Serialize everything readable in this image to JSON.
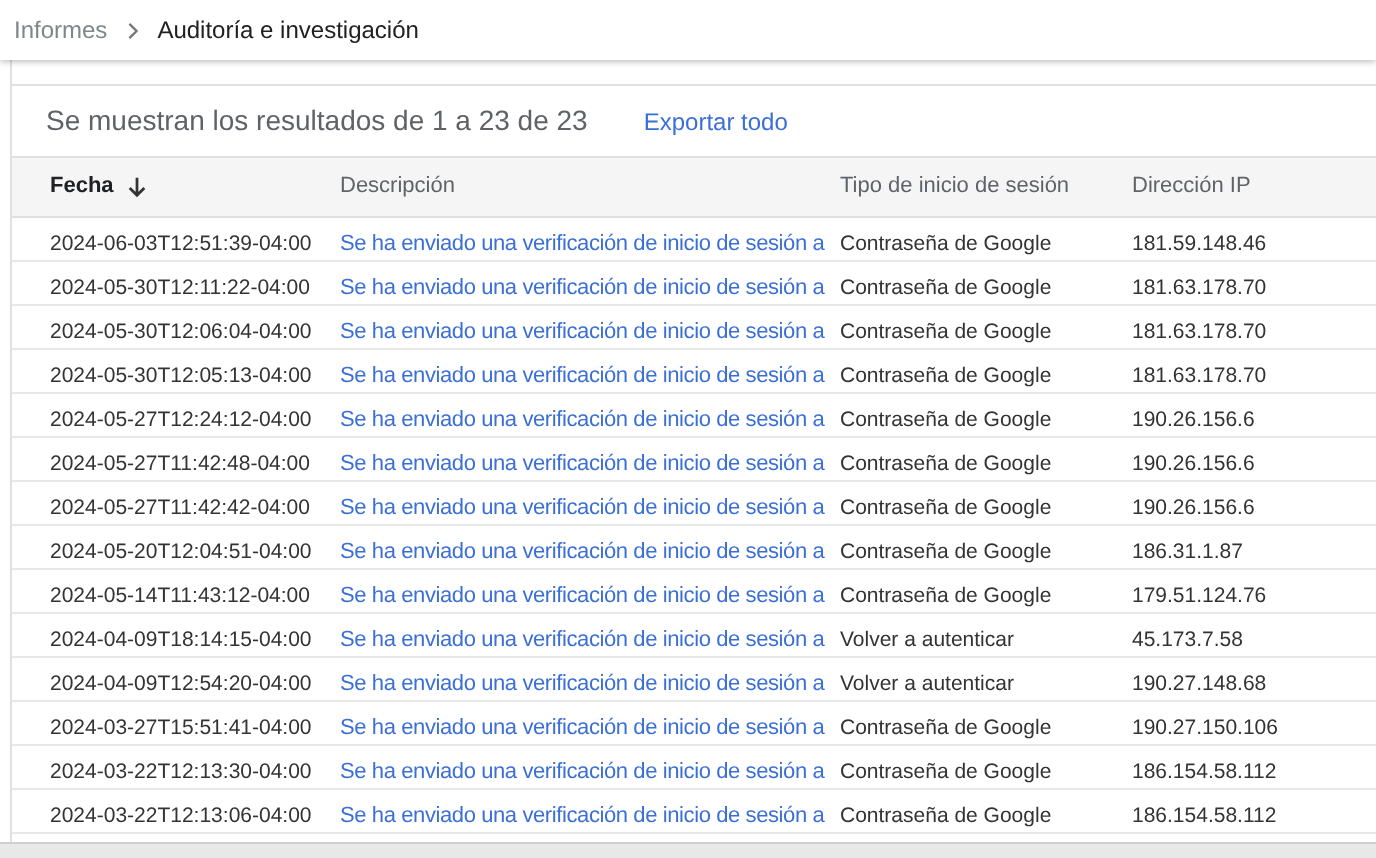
{
  "breadcrumb": [
    {
      "label": "Informes"
    },
    {
      "label": "Auditoría e investigación"
    }
  ],
  "results": {
    "summary": "Se muestran los resultados de 1 a 23 de 23",
    "export_link": "Exportar todo"
  },
  "table": {
    "columns": [
      {
        "label": "Fecha",
        "sorted": true
      },
      {
        "label": "Descripción",
        "sorted": false
      },
      {
        "label": "Tipo de inicio de sesión",
        "sorted": false
      },
      {
        "label": "Dirección IP",
        "sorted": false
      }
    ],
    "rows": [
      [
        "2024-06-03T12:51:39-04:00",
        "Se ha enviado una verificación de inicio de sesión a",
        "Contraseña de Google",
        "181.59.148.46"
      ],
      [
        "2024-05-30T12:11:22-04:00",
        "Se ha enviado una verificación de inicio de sesión a",
        "Contraseña de Google",
        "181.63.178.70"
      ],
      [
        "2024-05-30T12:06:04-04:00",
        "Se ha enviado una verificación de inicio de sesión a",
        "Contraseña de Google",
        "181.63.178.70"
      ],
      [
        "2024-05-30T12:05:13-04:00",
        "Se ha enviado una verificación de inicio de sesión a",
        "Contraseña de Google",
        "181.63.178.70"
      ],
      [
        "2024-05-27T12:24:12-04:00",
        "Se ha enviado una verificación de inicio de sesión a",
        "Contraseña de Google",
        "190.26.156.6"
      ],
      [
        "2024-05-27T11:42:48-04:00",
        "Se ha enviado una verificación de inicio de sesión a",
        "Contraseña de Google",
        "190.26.156.6"
      ],
      [
        "2024-05-27T11:42:42-04:00",
        "Se ha enviado una verificación de inicio de sesión a",
        "Contraseña de Google",
        "190.26.156.6"
      ],
      [
        "2024-05-20T12:04:51-04:00",
        "Se ha enviado una verificación de inicio de sesión a",
        "Contraseña de Google",
        "186.31.1.87"
      ],
      [
        "2024-05-14T11:43:12-04:00",
        "Se ha enviado una verificación de inicio de sesión a",
        "Contraseña de Google",
        "179.51.124.76"
      ],
      [
        "2024-04-09T18:14:15-04:00",
        "Se ha enviado una verificación de inicio de sesión a",
        "Volver a autenticar",
        "45.173.7.58"
      ],
      [
        "2024-04-09T12:54:20-04:00",
        "Se ha enviado una verificación de inicio de sesión a",
        "Volver a autenticar",
        "190.27.148.68"
      ],
      [
        "2024-03-27T15:51:41-04:00",
        "Se ha enviado una verificación de inicio de sesión a",
        "Contraseña de Google",
        "190.27.150.106"
      ],
      [
        "2024-03-22T12:13:30-04:00",
        "Se ha enviado una verificación de inicio de sesión a",
        "Contraseña de Google",
        "186.154.58.112"
      ],
      [
        "2024-03-22T12:13:06-04:00",
        "Se ha enviado una verificación de inicio de sesión a",
        "Contraseña de Google",
        "186.154.58.112"
      ]
    ]
  }
}
